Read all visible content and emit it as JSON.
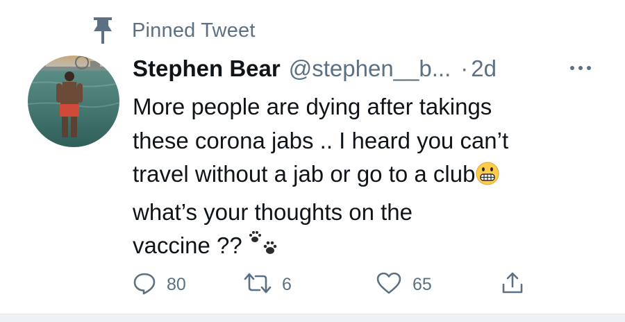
{
  "pinned": {
    "label": "Pinned Tweet",
    "icon": "pin-icon"
  },
  "author": {
    "display_name": "Stephen Bear",
    "handle": "@stephen__b...",
    "separator": "·",
    "time": "2d"
  },
  "tweet": {
    "lines": [
      "More people are dying after takings",
      "these corona jabs .. I heard you can’t",
      "travel without a jab or go to a club",
      "what’s your thoughts on the",
      "vaccine ??"
    ],
    "emojis": [
      "grimacing-face-emoji",
      "paw-prints-emoji"
    ]
  },
  "actions": {
    "reply_count": "80",
    "retweet_count": "6",
    "like_count": "65"
  },
  "colors": {
    "secondary_text": "#5b7083",
    "primary_text": "#0f1419",
    "emoji_yellow": "#ffcb4c"
  }
}
